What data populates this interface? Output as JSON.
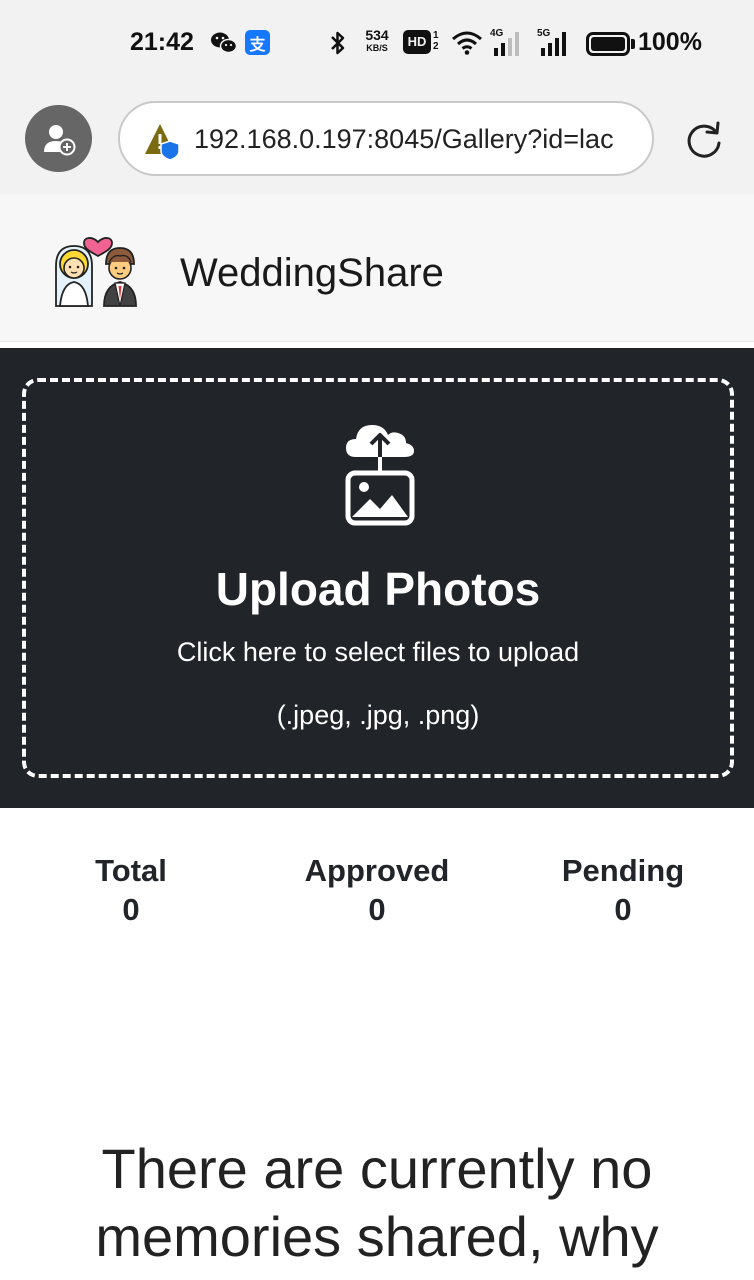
{
  "status_bar": {
    "time": "21:42",
    "speed_value": "534",
    "speed_unit": "KB/S",
    "hd_label": "HD",
    "hd_sub_top": "1",
    "hd_sub_bottom": "2",
    "net_4g": "4G",
    "net_5g": "5G",
    "battery_percent": "100%",
    "icons": [
      "wechat-icon",
      "alipay-icon",
      "bluetooth-icon",
      "wifi-icon",
      "signal-icon",
      "battery-icon"
    ],
    "alipay_glyph": "支"
  },
  "browser": {
    "url": "192.168.0.197:8045/Gallery?id=lac",
    "icons": [
      "profile-icon",
      "warning-shield-icon",
      "reload-icon"
    ]
  },
  "site": {
    "title": "WeddingShare"
  },
  "upload": {
    "title": "Upload Photos",
    "subtitle": "Click here to select files to upload",
    "file_types": "(.jpeg, .jpg, .png)"
  },
  "stats": [
    {
      "label": "Total",
      "value": "0"
    },
    {
      "label": "Approved",
      "value": "0"
    },
    {
      "label": "Pending",
      "value": "0"
    }
  ],
  "empty_message": "There are currently no memories shared, why",
  "colors": {
    "upload_bg": "#212529",
    "status_bg": "#f2f2f2",
    "header_bg": "#f7f7f7"
  }
}
